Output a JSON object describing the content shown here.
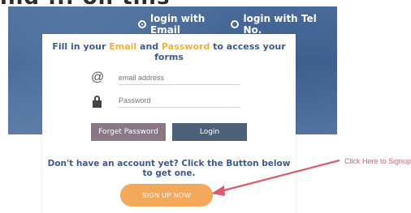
{
  "top_heading": "ind ... on this",
  "login_method": {
    "email_label": "login with Email",
    "tel_label": "login with Tel No."
  },
  "form": {
    "fill_prefix": "Fill in your ",
    "email_word": "Email",
    "and_word": " and ",
    "password_word": "Password",
    "fill_suffix": " to access your forms",
    "email_placeholder": "email address",
    "password_placeholder": "Password",
    "forget_label": "Forget Password",
    "login_label": "Login",
    "signup_prompt": "Don't have an account yet? Click the Button below to get one.",
    "signup_label": "SIGN UP NOW"
  },
  "annotation": {
    "hint": "Click Here to Signup"
  },
  "colors": {
    "accent_orange": "#f3a85b",
    "highlight_yellow": "#f2b13a",
    "text_blue": "#3d5a8a",
    "arrow_red": "#e05a6d"
  },
  "icons": {
    "email": "at-icon",
    "password": "lock-icon"
  }
}
